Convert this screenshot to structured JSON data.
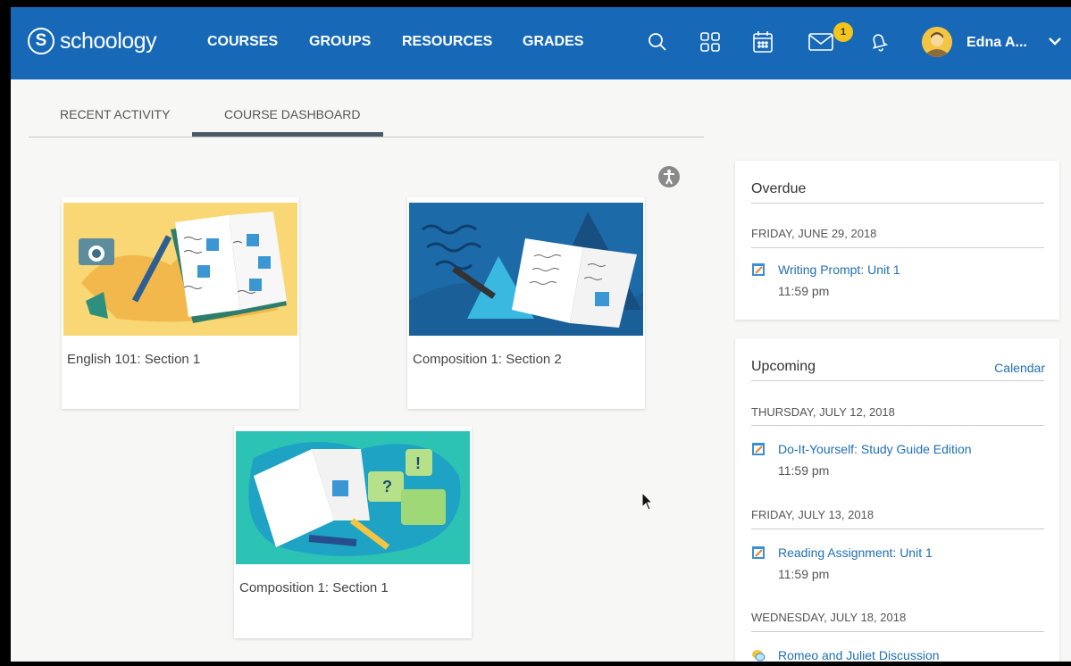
{
  "brand": {
    "logo_letter": "S",
    "logo_text": "schoology"
  },
  "nav": {
    "links": [
      "COURSES",
      "GROUPS",
      "RESOURCES",
      "GRADES"
    ],
    "message_badge": "1",
    "user_name": "Edna A...",
    "icons": [
      "search-icon",
      "apps-grid-icon",
      "calendar-icon",
      "mail-icon",
      "bell-icon",
      "avatar",
      "chevron-down-icon"
    ]
  },
  "tabs": {
    "recent": "RECENT ACTIVITY",
    "dashboard": "COURSE DASHBOARD",
    "active": "COURSE DASHBOARD"
  },
  "courses": [
    {
      "title": "English 101: Section 1"
    },
    {
      "title": "Composition 1: Section 2"
    },
    {
      "title": "Composition 1: Section 1"
    }
  ],
  "overdue": {
    "title": "Overdue",
    "date": "FRIDAY, JUNE 29, 2018",
    "items": [
      {
        "name": "Writing Prompt: Unit 1",
        "time": "11:59 pm"
      }
    ]
  },
  "upcoming": {
    "title": "Upcoming",
    "calendar_link": "Calendar",
    "groups": [
      {
        "date": "THURSDAY, JULY 12, 2018",
        "name": "Do-It-Yourself: Study Guide Edition",
        "time": "11:59 pm"
      },
      {
        "date": "FRIDAY, JULY 13, 2018",
        "name": "Reading Assignment: Unit 1",
        "time": "11:59 pm"
      },
      {
        "date": "WEDNESDAY, JULY 18, 2018",
        "name": "Romeo and Juliet Discussion",
        "time": ""
      }
    ]
  },
  "colors": {
    "nav_bg": "#1769b8",
    "link": "#1f6fb7",
    "badge": "#f5c51b",
    "tab_active": "#4b5a66"
  }
}
